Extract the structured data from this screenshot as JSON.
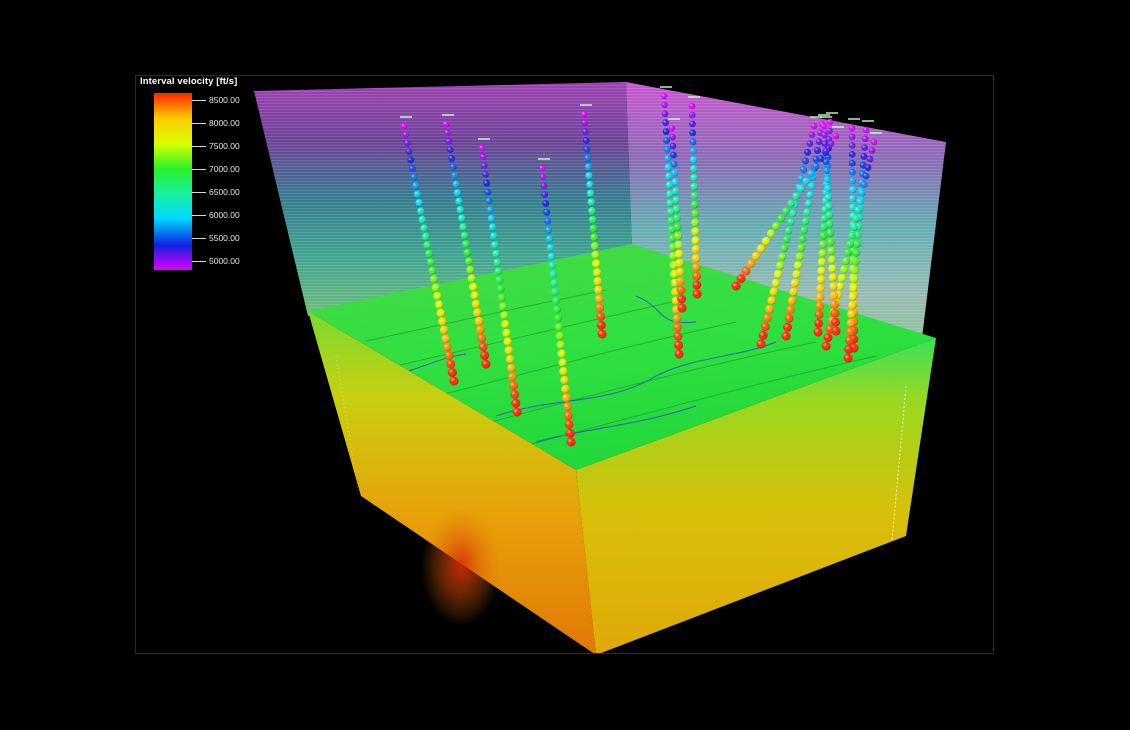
{
  "legend": {
    "title": "Interval velocity [ft/s]",
    "ticks": [
      "8500.00",
      "8000.00",
      "7500.00",
      "7000.00",
      "6500.00",
      "6000.00",
      "5500.00",
      "5000.00"
    ],
    "colors": [
      "#ff2400",
      "#ffc800",
      "#d8ff00",
      "#28f028",
      "#18f0a0",
      "#00d8ff",
      "#1020e0",
      "#e000ff"
    ]
  },
  "scene": {
    "description_icon": "3d-seismic-volume",
    "well_count": 16
  }
}
